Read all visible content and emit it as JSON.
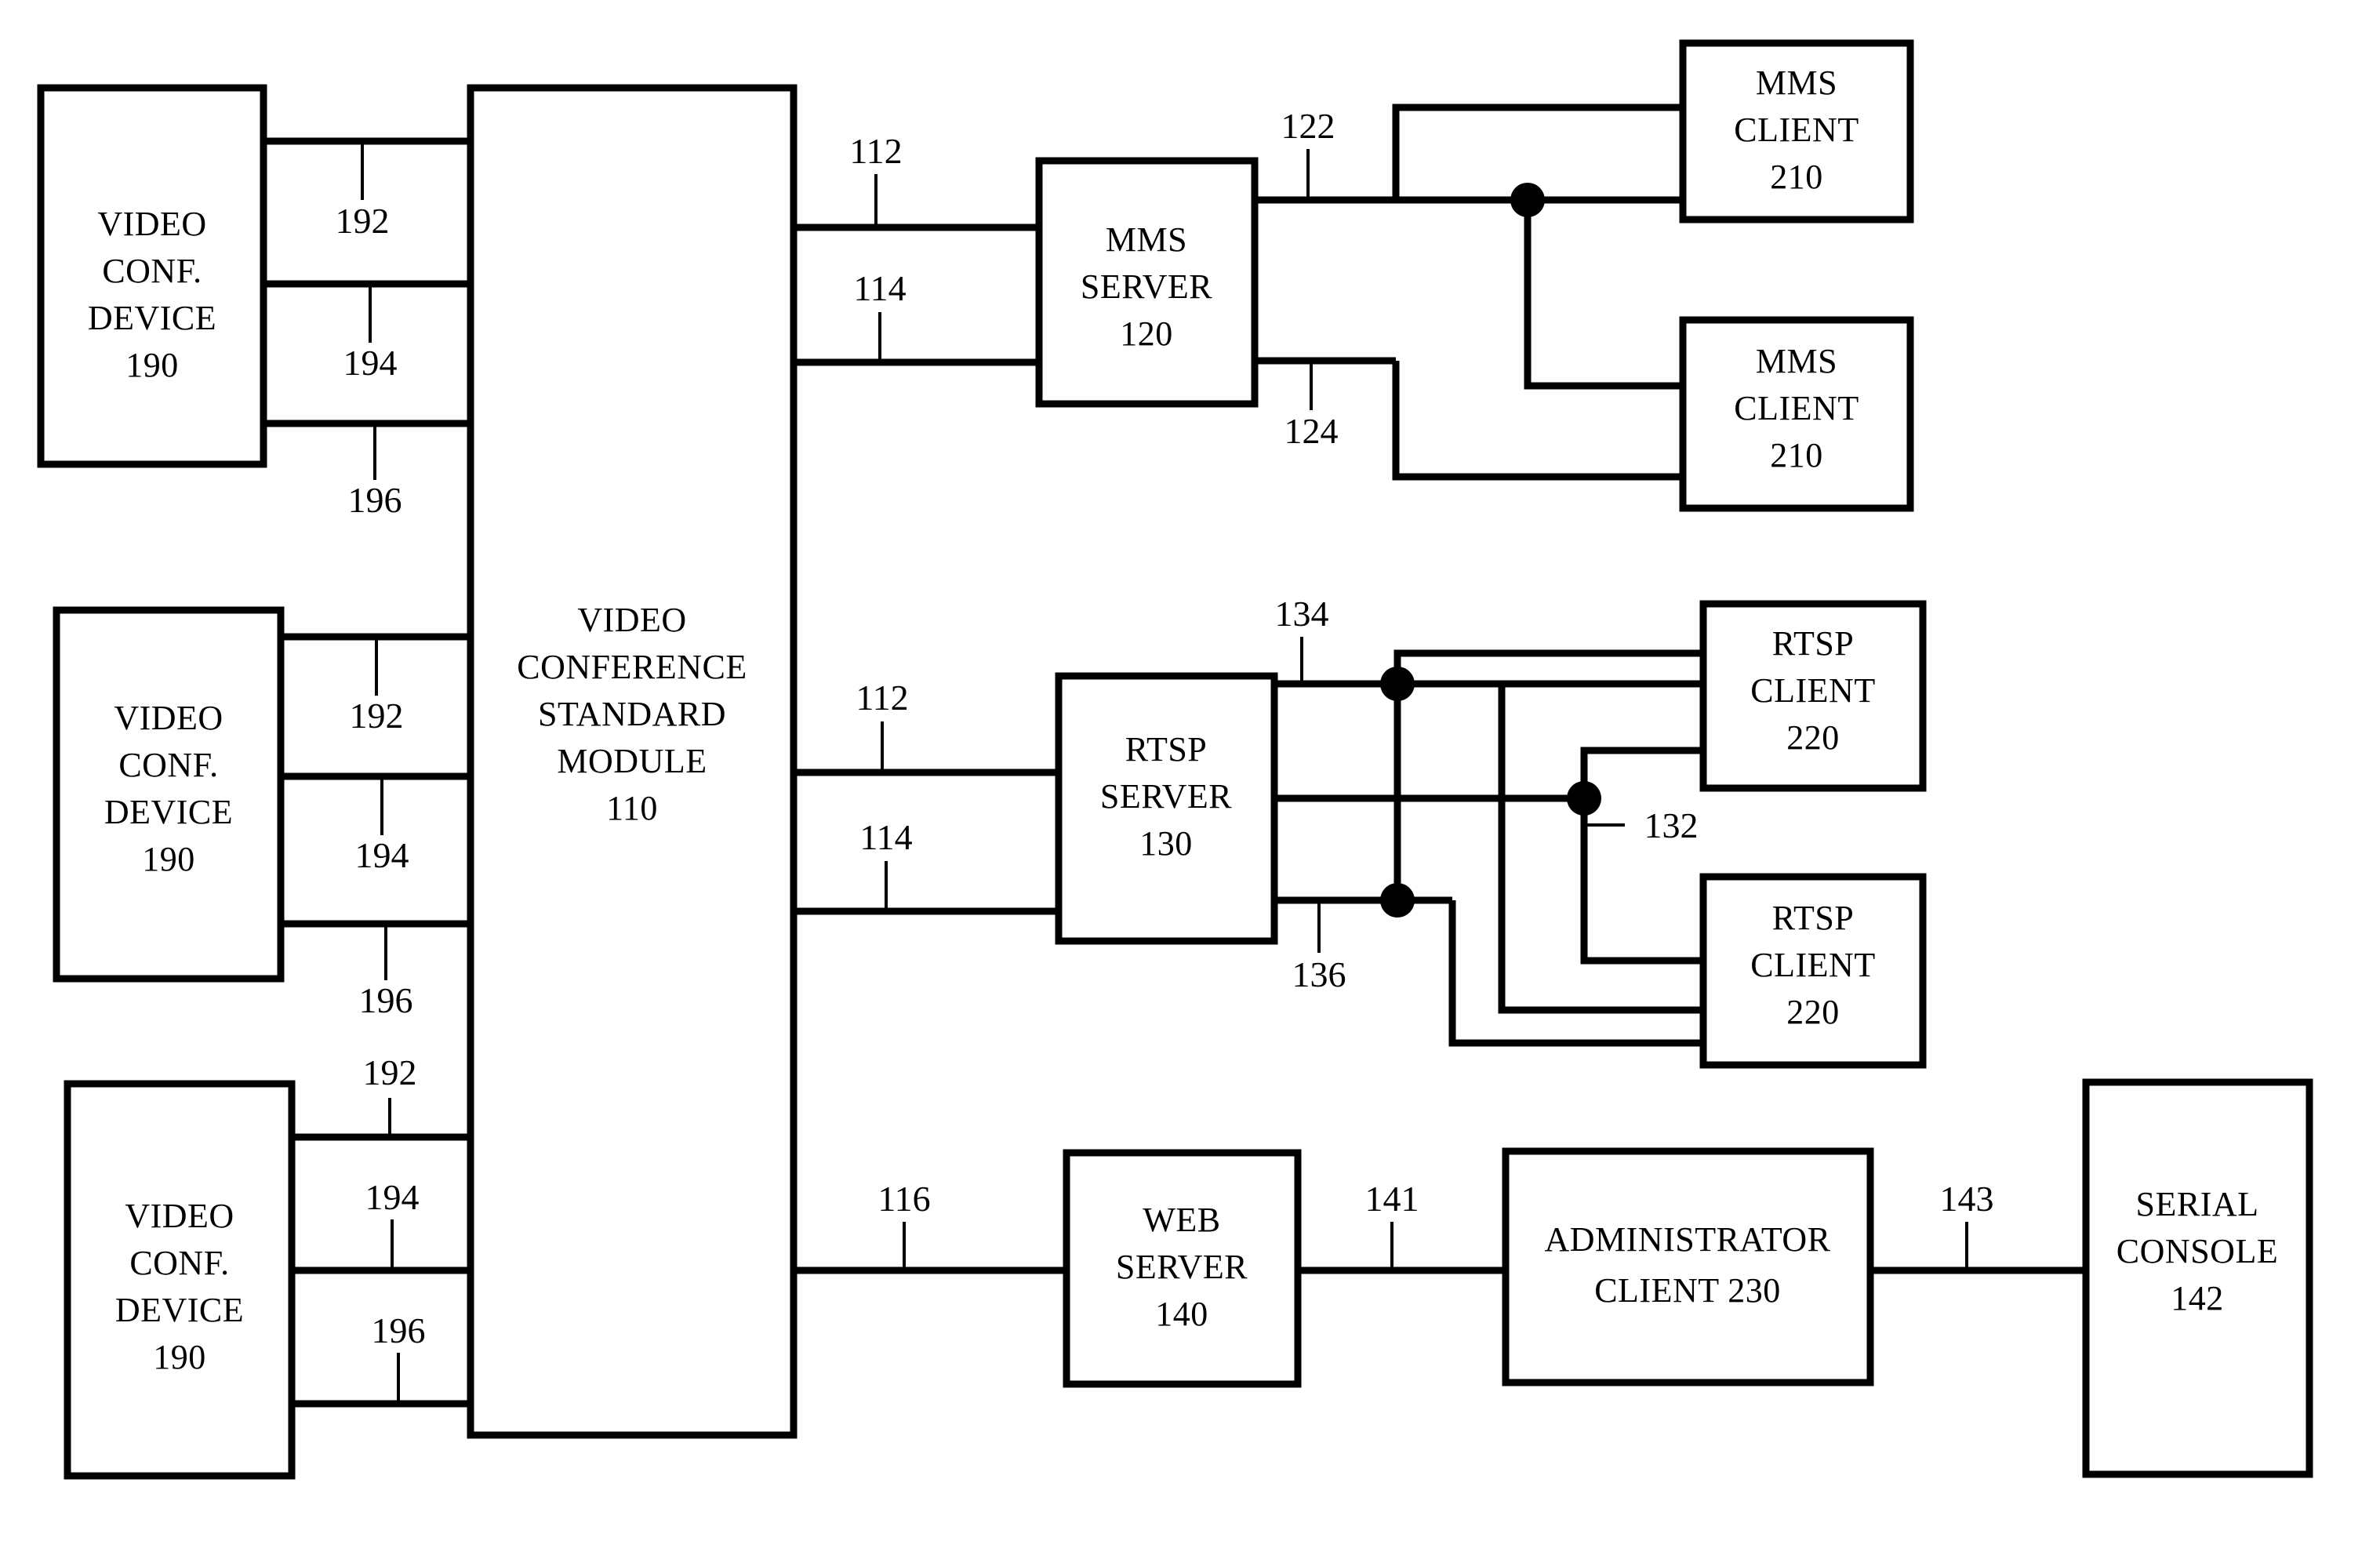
{
  "figure": {
    "type": "patent-block-diagram",
    "background_color": "#ffffff",
    "line_color": "#000000"
  },
  "blocks": {
    "vcd_top": {
      "lines": [
        "VIDEO",
        "CONF.",
        "DEVICE",
        "190"
      ]
    },
    "vcd_mid": {
      "lines": [
        "VIDEO",
        "CONF.",
        "DEVICE",
        "190"
      ]
    },
    "vcd_bottom": {
      "lines": [
        "VIDEO",
        "CONF.",
        "DEVICE",
        "190"
      ]
    },
    "standard_module": {
      "lines": [
        "VIDEO",
        "CONFERENCE",
        "STANDARD",
        "MODULE",
        "110"
      ]
    },
    "mms_server": {
      "lines": [
        "MMS",
        "SERVER",
        "120"
      ]
    },
    "rtsp_server": {
      "lines": [
        "RTSP",
        "SERVER",
        "130"
      ]
    },
    "web_server": {
      "lines": [
        "WEB",
        "SERVER",
        "140"
      ]
    },
    "mms_client_top": {
      "lines": [
        "MMS",
        "CLIENT",
        "210"
      ]
    },
    "mms_client_bottom": {
      "lines": [
        "MMS",
        "CLIENT",
        "210"
      ]
    },
    "rtsp_client_top": {
      "lines": [
        "RTSP",
        "CLIENT",
        "220"
      ]
    },
    "rtsp_client_bottom": {
      "lines": [
        "RTSP",
        "CLIENT",
        "220"
      ]
    },
    "admin_client": {
      "lines": [
        "ADMINISTRATOR",
        "CLIENT 230"
      ]
    },
    "serial_console": {
      "lines": [
        "SERIAL",
        "CONSOLE",
        "142"
      ]
    }
  },
  "reference_numerals": {
    "vcd_top_192": "192",
    "vcd_top_194": "194",
    "vcd_top_196": "196",
    "vcd_mid_192": "192",
    "vcd_mid_194": "194",
    "vcd_mid_196": "196",
    "vcd_bottom_192": "192",
    "vcd_bottom_194": "194",
    "vcd_bottom_196": "196",
    "mms_in_112": "112",
    "mms_in_114": "114",
    "mms_out_122": "122",
    "mms_out_124": "124",
    "rtsp_in_112": "112",
    "rtsp_in_114": "114",
    "rtsp_out_134": "134",
    "rtsp_out_132": "132",
    "rtsp_out_136": "136",
    "web_in_116": "116",
    "web_out_141": "141",
    "admin_out_143": "143"
  }
}
